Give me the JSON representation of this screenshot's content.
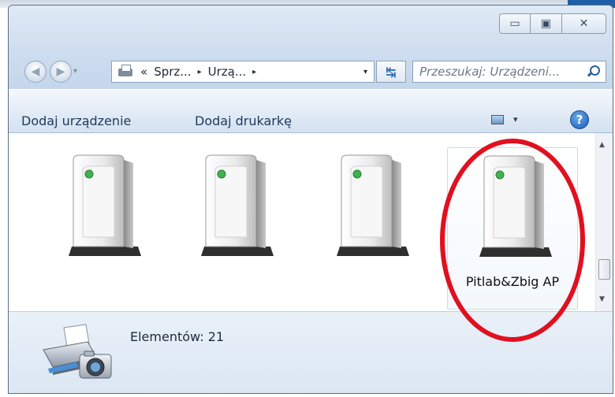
{
  "window": {
    "caption_buttons": {
      "minimize": "▭",
      "maximize": "▣",
      "close": "✕"
    }
  },
  "navigation": {
    "address_prefix": "«",
    "breadcrumb": [
      "Sprz...",
      "Urzą..."
    ],
    "separator": "▸",
    "dropdown_arrow": "▾",
    "refresh_glyph": "↹",
    "search_placeholder": "Przeszukaj: Urządzeni..."
  },
  "toolbar": {
    "add_device": "Dodaj urządzenie",
    "add_printer": "Dodaj drukarkę",
    "view_dropdown_arrow": "▾",
    "help": "?"
  },
  "devices": [
    {
      "label": ""
    },
    {
      "label": ""
    },
    {
      "label": ""
    },
    {
      "label": "Pitlab&Zbig AP",
      "selected": true
    }
  ],
  "status": {
    "item_count": "Elementów: 21"
  },
  "scrollbar": {
    "up": "▲",
    "down": "▼"
  },
  "colors": {
    "highlight": "#e01020",
    "accent": "#1c5bb5",
    "device_led": "#3fb34f"
  },
  "icons": {
    "address": "printer-icon",
    "search": "search-icon",
    "help": "help-icon",
    "device": "access-point-icon",
    "details": "printer-camera-icon"
  }
}
